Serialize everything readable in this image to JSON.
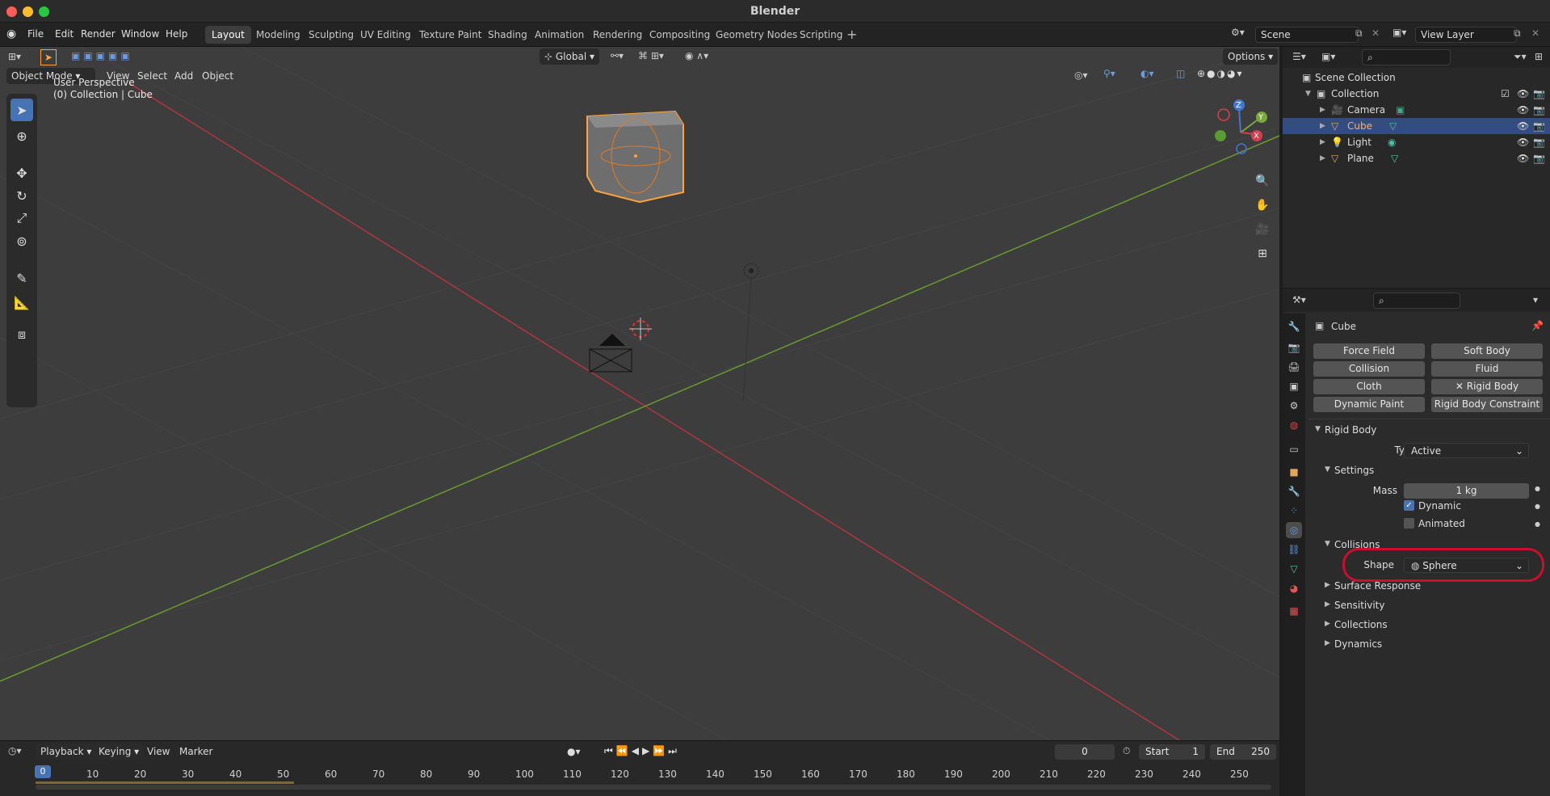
{
  "window": {
    "title": "Blender"
  },
  "menu": [
    "File",
    "Edit",
    "Render",
    "Window",
    "Help"
  ],
  "workspaces": [
    {
      "label": "Layout",
      "active": true
    },
    {
      "label": "Modeling",
      "active": false
    },
    {
      "label": "Sculpting",
      "active": false
    },
    {
      "label": "UV Editing",
      "active": false
    },
    {
      "label": "Texture Paint",
      "active": false
    },
    {
      "label": "Shading",
      "active": false
    },
    {
      "label": "Animation",
      "active": false
    },
    {
      "label": "Rendering",
      "active": false
    },
    {
      "label": "Compositing",
      "active": false
    },
    {
      "label": "Geometry Nodes",
      "active": false
    },
    {
      "label": "Scripting",
      "active": false
    }
  ],
  "scene": {
    "name": "Scene"
  },
  "view_layer": {
    "name": "View Layer"
  },
  "viewport": {
    "mode": "Object Mode",
    "menus": [
      "View",
      "Select",
      "Add",
      "Object"
    ],
    "orientation": "Global",
    "options_label": "Options",
    "info_line1": "User Perspective",
    "info_line2": "(0) Collection | Cube",
    "gizmo": {
      "z": "Z",
      "y": "Y",
      "x": "X"
    }
  },
  "outliner": {
    "root": "Scene Collection",
    "collection": "Collection",
    "items": [
      {
        "name": "Camera",
        "selected": false,
        "color": "#e3a75a"
      },
      {
        "name": "Cube",
        "selected": true,
        "color": "#e3a75a"
      },
      {
        "name": "Light",
        "selected": false,
        "color": "#e3a75a"
      },
      {
        "name": "Plane",
        "selected": false,
        "color": "#e3a75a"
      }
    ]
  },
  "properties": {
    "object_name": "Cube",
    "physics_buttons": [
      {
        "label": "Force Field"
      },
      {
        "label": "Soft Body"
      },
      {
        "label": "Collision"
      },
      {
        "label": "Fluid"
      },
      {
        "label": "Cloth"
      },
      {
        "label": "Rigid Body"
      },
      {
        "label": "Dynamic Paint"
      },
      {
        "label": "Rigid Body Constraint"
      }
    ],
    "rigid_body": {
      "header": "Rigid Body",
      "type_label": "Type",
      "type_value": "Active",
      "settings_header": "Settings",
      "mass_label": "Mass",
      "mass_value": "1 kg",
      "dynamic_label": "Dynamic",
      "dynamic_checked": true,
      "animated_label": "Animated",
      "animated_checked": false,
      "collisions_header": "Collisions",
      "shape_label": "Shape",
      "shape_value": "Sphere",
      "subpanels": [
        "Surface Response",
        "Sensitivity",
        "Collections",
        "Dynamics"
      ]
    }
  },
  "timeline": {
    "menus": [
      "Playback",
      "Keying",
      "View",
      "Marker"
    ],
    "current_frame": "0",
    "start_label": "Start",
    "start_value": "1",
    "end_label": "End",
    "end_value": "250",
    "ticks": [
      "0",
      "10",
      "20",
      "30",
      "40",
      "50",
      "60",
      "70",
      "80",
      "90",
      "100",
      "110",
      "120",
      "130",
      "140",
      "150",
      "160",
      "170",
      "180",
      "190",
      "200",
      "210",
      "220",
      "230",
      "240",
      "250"
    ]
  },
  "colors": {
    "accent": "#4772b3",
    "selection": "#ffa33a",
    "highlight_ring": "#c8102e"
  }
}
